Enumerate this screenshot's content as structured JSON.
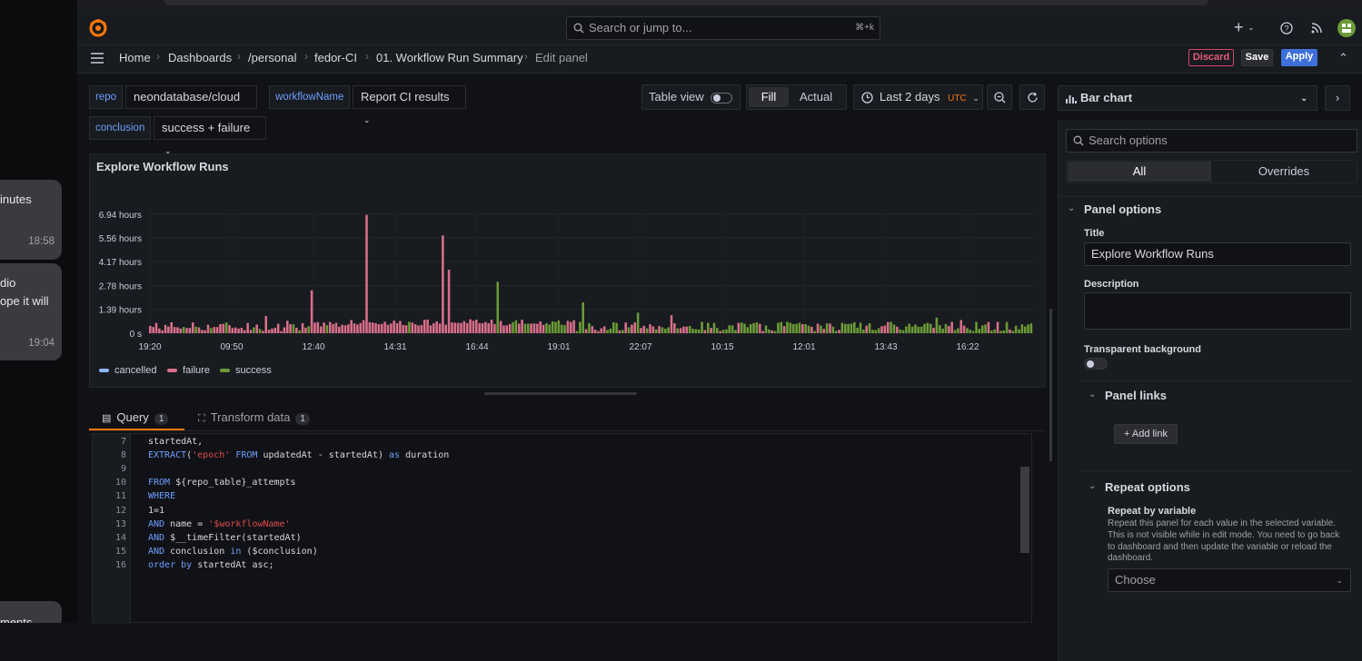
{
  "chat": {
    "bubbles": [
      {
        "text": "inutes",
        "time": "18:58"
      },
      {
        "text": "dio\nope it will",
        "time": "19:04"
      },
      {
        "text": "ments",
        "time": ""
      }
    ]
  },
  "topbar": {
    "search_placeholder": "Search or jump to...",
    "search_shortcut": "⌘+k",
    "plus": "+",
    "colors": {
      "bg": "#181b1f",
      "accent": "#ff780a",
      "primary": "#3d71d9"
    }
  },
  "breadcrumbs": [
    "Home",
    "Dashboards",
    "/personal",
    "fedor-CI",
    "01. Workflow Run Summary",
    "Edit panel"
  ],
  "actions": {
    "discard": "Discard",
    "save": "Save",
    "apply": "Apply"
  },
  "variables": [
    {
      "label": "repo",
      "value": "neondatabase/cloud"
    },
    {
      "label": "workflowName",
      "value": "Report CI results"
    },
    {
      "label": "conclusion",
      "value": "success + failure"
    }
  ],
  "toolbar": {
    "table_view": "Table view",
    "fill": "Fill",
    "actual": "Actual",
    "time_range": "Last 2 days",
    "timezone": "UTC"
  },
  "panel": {
    "title": "Explore Workflow Runs"
  },
  "chart_data": {
    "type": "bar",
    "title": "Explore Workflow Runs",
    "yticks": [
      "6.94 hours",
      "5.56 hours",
      "4.17 hours",
      "2.78 hours",
      "1.39 hours",
      "0 s"
    ],
    "ylim": [
      0,
      7.2
    ],
    "xticks": [
      "19:20",
      "09:50",
      "12:40",
      "14:31",
      "16:44",
      "19:01",
      "22:07",
      "10:15",
      "12:01",
      "13:43",
      "16:22"
    ],
    "legend": [
      "cancelled",
      "failure",
      "success"
    ],
    "legend_position": "bottom-left",
    "colors": {
      "cancelled": "#8ab8ff",
      "failure": "#d86f8a",
      "success": "#6b9b37"
    },
    "grid": true,
    "series_note_values": {
      "peaks": [
        {
          "x_fraction": 0.244,
          "hours": 6.9,
          "status": "failure"
        },
        {
          "x_fraction": 0.332,
          "hours": 5.7,
          "status": "failure"
        },
        {
          "x_fraction": 0.184,
          "hours": 2.5,
          "status": "failure"
        },
        {
          "x_fraction": 0.339,
          "hours": 3.7,
          "status": "failure"
        },
        {
          "x_fraction": 0.394,
          "hours": 3.0,
          "status": "success"
        },
        {
          "x_fraction": 0.49,
          "hours": 1.8,
          "status": "success"
        },
        {
          "x_fraction": 0.13,
          "hours": 1.0,
          "status": "failure"
        },
        {
          "x_fraction": 0.55,
          "hours": 1.2,
          "status": "success"
        }
      ]
    }
  },
  "query_tabs": [
    {
      "label": "Query",
      "count": "1"
    },
    {
      "label": "Transform data",
      "count": "1"
    }
  ],
  "editor": {
    "lines": [
      {
        "n": "7",
        "code": "startedAt,"
      },
      {
        "n": "8",
        "code": "EXTRACT('epoch' FROM updatedAt - startedAt) as duration"
      },
      {
        "n": "9",
        "code": ""
      },
      {
        "n": "10",
        "code": "FROM ${repo_table}_attempts"
      },
      {
        "n": "11",
        "code": "WHERE"
      },
      {
        "n": "12",
        "code": "1=1"
      },
      {
        "n": "13",
        "code": "AND name = '$workflowName'"
      },
      {
        "n": "14",
        "code": "AND $__timeFilter(startedAt)"
      },
      {
        "n": "15",
        "code": "AND conclusion in ($conclusion)"
      },
      {
        "n": "16",
        "code": "order by startedAt asc;"
      }
    ]
  },
  "options": {
    "viz": "Bar chart",
    "search_placeholder": "Search options",
    "tab_all": "All",
    "tab_overrides": "Overrides",
    "panel_options": "Panel options",
    "title_label": "Title",
    "title_value": "Explore Workflow Runs",
    "description_label": "Description",
    "transparent_label": "Transparent background",
    "panel_links": "Panel links",
    "add_link": "Add link",
    "repeat_options": "Repeat options",
    "repeat_by_variable": "Repeat by variable",
    "repeat_help": "Repeat this panel for each value in the selected variable. This is not visible while in edit mode. You need to go back to dashboard and then update the variable or reload the dashboard.",
    "choose": "Choose"
  }
}
